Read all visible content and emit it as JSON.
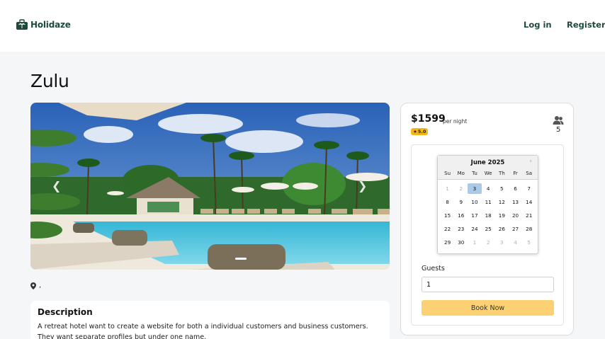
{
  "header": {
    "brand": "Holidaze",
    "nav": {
      "login": "Log in",
      "register": "Register"
    }
  },
  "venue": {
    "name": "Zulu",
    "location": ",",
    "description_title": "Description",
    "description": "A retreat hotel want to create a website for both a individual customers and business customers. They want separate profiles but under one name."
  },
  "booking": {
    "price": "$1599",
    "per_night": "per night",
    "rating": "5.0",
    "max_guests": "5",
    "calendar": {
      "month": "June 2025",
      "weekdays": [
        "Su",
        "Mo",
        "Tu",
        "We",
        "Th",
        "Fr",
        "Sa"
      ],
      "days": [
        {
          "d": "1",
          "muted": true
        },
        {
          "d": "2",
          "muted": true
        },
        {
          "d": "3",
          "selected": true
        },
        {
          "d": "4"
        },
        {
          "d": "5"
        },
        {
          "d": "6"
        },
        {
          "d": "7"
        },
        {
          "d": "8"
        },
        {
          "d": "9"
        },
        {
          "d": "10"
        },
        {
          "d": "11"
        },
        {
          "d": "12"
        },
        {
          "d": "13"
        },
        {
          "d": "14"
        },
        {
          "d": "15"
        },
        {
          "d": "16"
        },
        {
          "d": "17"
        },
        {
          "d": "18"
        },
        {
          "d": "19"
        },
        {
          "d": "20"
        },
        {
          "d": "21"
        },
        {
          "d": "22"
        },
        {
          "d": "23"
        },
        {
          "d": "24"
        },
        {
          "d": "25"
        },
        {
          "d": "26"
        },
        {
          "d": "27"
        },
        {
          "d": "28"
        },
        {
          "d": "29"
        },
        {
          "d": "30"
        },
        {
          "d": "1",
          "muted": true
        },
        {
          "d": "2",
          "muted": true
        },
        {
          "d": "3",
          "muted": true
        },
        {
          "d": "4",
          "muted": true
        },
        {
          "d": "5",
          "muted": true
        }
      ]
    },
    "guests_label": "Guests",
    "guests_value": "1",
    "book_button": "Book Now"
  },
  "colors": {
    "brand": "#1d4a3b",
    "book_button": "#fcd173",
    "rating_badge": "#f3b71a",
    "selected_day": "#a9cbe9"
  },
  "icons": {
    "logo": "palm-suitcase-icon",
    "location": "map-pin-icon",
    "guests": "users-icon",
    "rating": "star-icon",
    "carousel_prev": "chevron-left-icon",
    "carousel_next": "chevron-right-icon",
    "calendar_next": "chevron-right-icon"
  }
}
